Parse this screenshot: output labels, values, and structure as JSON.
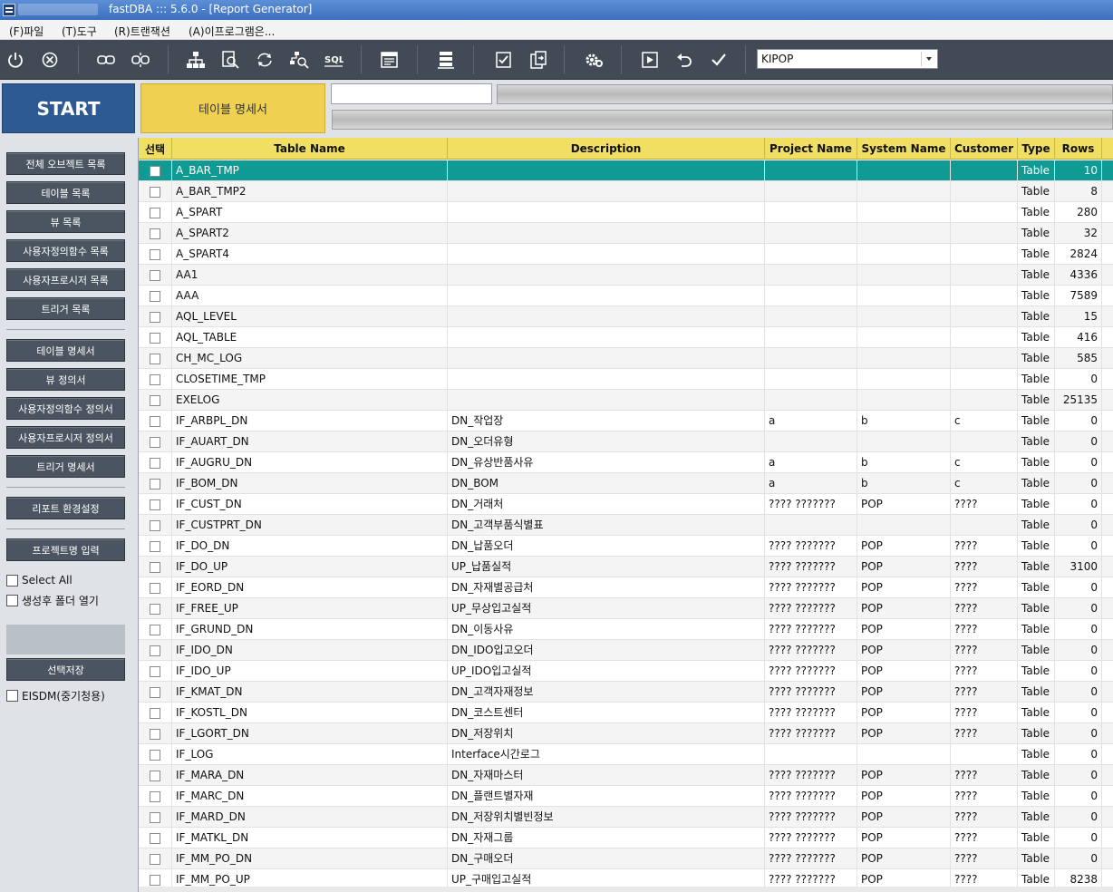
{
  "titlebar": {
    "title": "fastDBA ::: 5.6.0 - [Report Generator]"
  },
  "menu": [
    {
      "id": "file",
      "label": "(F)파일"
    },
    {
      "id": "tools",
      "label": "(T)도구"
    },
    {
      "id": "transaction",
      "label": "(R)트랜잭션"
    },
    {
      "id": "about",
      "label": "(A)이프로그램은..."
    }
  ],
  "toolbar": {
    "db_selected": "KIPOP"
  },
  "top": {
    "start_label": "START",
    "mode_label": "테이블 명세서",
    "path_value": ""
  },
  "sidebar": {
    "buttons": [
      {
        "id": "all-objects",
        "label": "전체 오브젝트 목록"
      },
      {
        "id": "table-list",
        "label": "테이블 목록"
      },
      {
        "id": "view-list",
        "label": "뷰 목록"
      },
      {
        "id": "function-list",
        "label": "사용자정의함수 목록"
      },
      {
        "id": "procedure-list",
        "label": "사용자프로시저 목록"
      },
      {
        "id": "trigger-list",
        "label": "트리거 목록"
      },
      {
        "id": "table-spec",
        "label": "테이블 명세서"
      },
      {
        "id": "view-spec",
        "label": "뷰 정의서"
      },
      {
        "id": "function-spec",
        "label": "사용자정의함수 정의서"
      },
      {
        "id": "procedure-spec",
        "label": "사용자프로시저 정의서"
      },
      {
        "id": "trigger-spec",
        "label": "트리거 명세서"
      },
      {
        "id": "report-settings",
        "label": "리포트 환경설정"
      },
      {
        "id": "project-name",
        "label": "프로젝트명 입력"
      }
    ],
    "select_all": "Select All",
    "open_folder": "생성후 폴더 열기",
    "save_selection": "선택저장",
    "eisdm": "EISDM(중기청용)"
  },
  "grid": {
    "columns": [
      "선택",
      "Table Name",
      "Description",
      "Project Name",
      "System Name",
      "Customer",
      "Type",
      "Rows"
    ],
    "rows": [
      [
        "",
        "A_BAR_TMP",
        "",
        "",
        "",
        "",
        "Table",
        "10"
      ],
      [
        "",
        "A_BAR_TMP2",
        "",
        "",
        "",
        "",
        "Table",
        "8"
      ],
      [
        "",
        "A_SPART",
        "",
        "",
        "",
        "",
        "Table",
        "280"
      ],
      [
        "",
        "A_SPART2",
        "",
        "",
        "",
        "",
        "Table",
        "32"
      ],
      [
        "",
        "A_SPART4",
        "",
        "",
        "",
        "",
        "Table",
        "2824"
      ],
      [
        "",
        "AA1",
        "",
        "",
        "",
        "",
        "Table",
        "4336"
      ],
      [
        "",
        "AAA",
        "",
        "",
        "",
        "",
        "Table",
        "7589"
      ],
      [
        "",
        "AQL_LEVEL",
        "",
        "",
        "",
        "",
        "Table",
        "15"
      ],
      [
        "",
        "AQL_TABLE",
        "",
        "",
        "",
        "",
        "Table",
        "416"
      ],
      [
        "",
        "CH_MC_LOG",
        "",
        "",
        "",
        "",
        "Table",
        "585"
      ],
      [
        "",
        "CLOSETIME_TMP",
        "",
        "",
        "",
        "",
        "Table",
        "0"
      ],
      [
        "",
        "EXELOG",
        "",
        "",
        "",
        "",
        "Table",
        "25135"
      ],
      [
        "",
        "IF_ARBPL_DN",
        "DN_작업장",
        "a",
        "b",
        "c",
        "Table",
        "0"
      ],
      [
        "",
        "IF_AUART_DN",
        "DN_오더유형",
        "",
        "",
        "",
        "Table",
        "0"
      ],
      [
        "",
        "IF_AUGRU_DN",
        "DN_유상반품사유",
        "a",
        "b",
        "c",
        "Table",
        "0"
      ],
      [
        "",
        "IF_BOM_DN",
        "DN_BOM",
        "a",
        "b",
        "c",
        "Table",
        "0"
      ],
      [
        "",
        "IF_CUST_DN",
        "DN_거래처",
        "???? ???????",
        "POP",
        "????",
        "Table",
        "0"
      ],
      [
        "",
        "IF_CUSTPRT_DN",
        "DN_고객부품식별표",
        "",
        "",
        "",
        "Table",
        "0"
      ],
      [
        "",
        "IF_DO_DN",
        "DN_납품오더",
        "???? ???????",
        "POP",
        "????",
        "Table",
        "0"
      ],
      [
        "",
        "IF_DO_UP",
        "UP_납품실적",
        "???? ???????",
        "POP",
        "????",
        "Table",
        "3100"
      ],
      [
        "",
        "IF_EORD_DN",
        "DN_자재별공급처",
        "???? ???????",
        "POP",
        "????",
        "Table",
        "0"
      ],
      [
        "",
        "IF_FREE_UP",
        "UP_무상입고실적",
        "???? ???????",
        "POP",
        "????",
        "Table",
        "0"
      ],
      [
        "",
        "IF_GRUND_DN",
        "DN_이동사유",
        "???? ???????",
        "POP",
        "????",
        "Table",
        "0"
      ],
      [
        "",
        "IF_IDO_DN",
        "DN_IDO입고오더",
        "???? ???????",
        "POP",
        "????",
        "Table",
        "0"
      ],
      [
        "",
        "IF_IDO_UP",
        "UP_IDO입고실적",
        "???? ???????",
        "POP",
        "????",
        "Table",
        "0"
      ],
      [
        "",
        "IF_KMAT_DN",
        "DN_고객자재정보",
        "???? ???????",
        "POP",
        "????",
        "Table",
        "0"
      ],
      [
        "",
        "IF_KOSTL_DN",
        "DN_코스트센터",
        "???? ???????",
        "POP",
        "????",
        "Table",
        "0"
      ],
      [
        "",
        "IF_LGORT_DN",
        "DN_저장위치",
        "???? ???????",
        "POP",
        "????",
        "Table",
        "0"
      ],
      [
        "",
        "IF_LOG",
        "Interface시간로그",
        "",
        "",
        "",
        "Table",
        "0"
      ],
      [
        "",
        "IF_MARA_DN",
        "DN_자재마스터",
        "???? ???????",
        "POP",
        "????",
        "Table",
        "0"
      ],
      [
        "",
        "IF_MARC_DN",
        "DN_플랜트별자재",
        "???? ???????",
        "POP",
        "????",
        "Table",
        "0"
      ],
      [
        "",
        "IF_MARD_DN",
        "DN_저장위치별빈정보",
        "???? ???????",
        "POP",
        "????",
        "Table",
        "0"
      ],
      [
        "",
        "IF_MATKL_DN",
        "DN_자재그룹",
        "???? ???????",
        "POP",
        "????",
        "Table",
        "0"
      ],
      [
        "",
        "IF_MM_PO_DN",
        "DN_구매오더",
        "???? ???????",
        "POP",
        "????",
        "Table",
        "0"
      ],
      [
        "",
        "IF_MM_PO_UP",
        "UP_구매입고실적",
        "???? ???????",
        "POP",
        "????",
        "Table",
        "8238"
      ]
    ],
    "selected_row": 0
  },
  "colors": {
    "toolbar": "#414a55",
    "start": "#2e5a93",
    "mode": "#f0d050",
    "header": "#f1df63",
    "selected": "#0f9a94"
  }
}
